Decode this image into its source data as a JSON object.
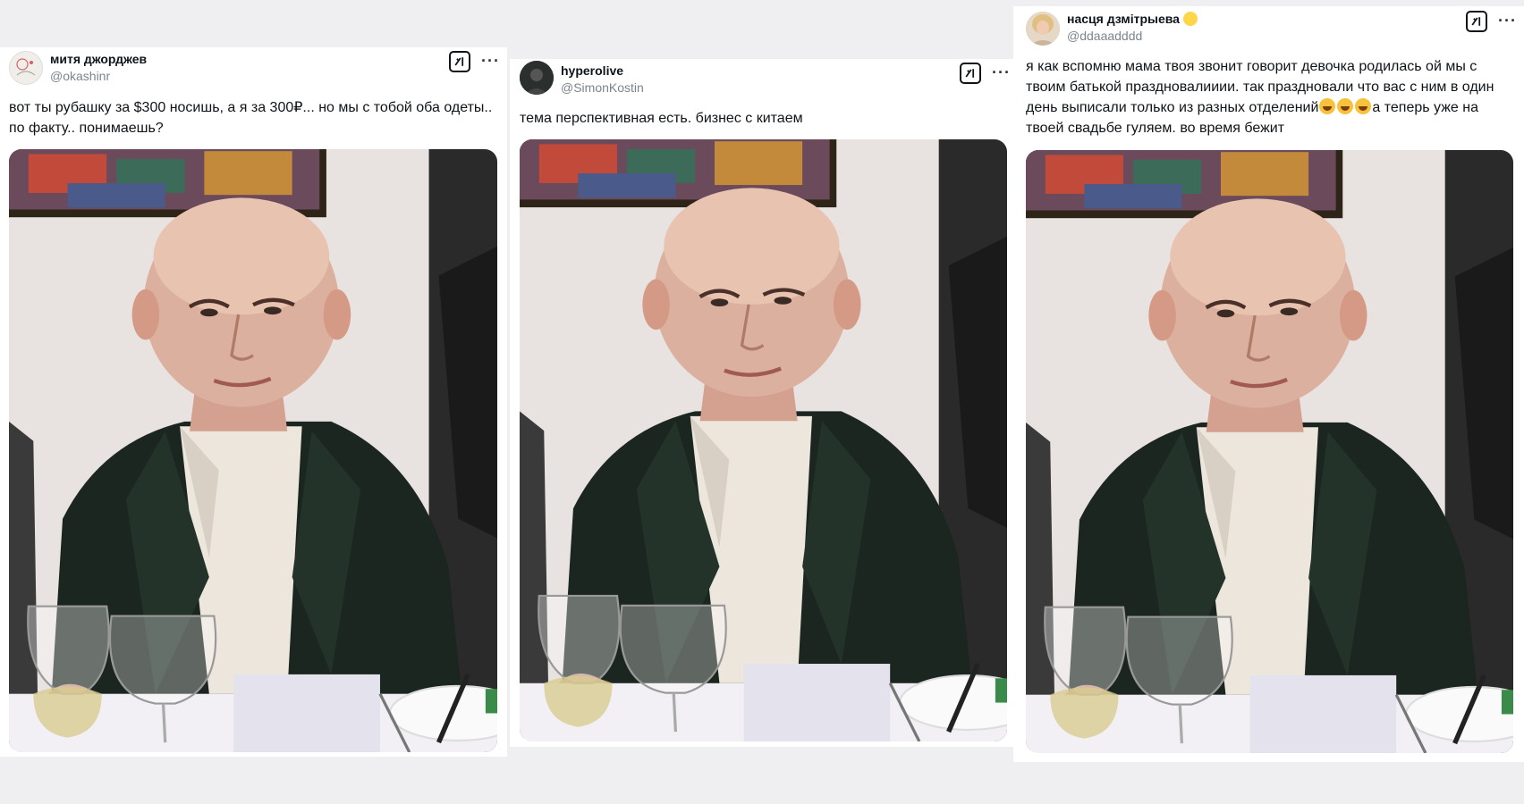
{
  "tweets": [
    {
      "name": "митя джорджев",
      "handle": "@okashinr",
      "text": "вот ты рубашку за $300 носишь, а я за 300₽... но мы с тобой оба одеты.. по факту.. понимаешь?",
      "avatar_icon": "avatar-sketch-icon"
    },
    {
      "name": "hyperolive",
      "handle": "@SimonKostin",
      "text": "тема перспективная есть. бизнес с китаем",
      "avatar_icon": "avatar-dark-icon"
    },
    {
      "name": "насця дзмітрыева",
      "handle": "@ddaaadddd",
      "text_part1": "я как вспомню мама твоя звонит говорит девочка родилась ой мы с твоим батькой праздновалииии. так праздновали что вас с ним в один день выписали только из разных отделений",
      "text_part2": "а теперь уже на твоей свадьбе гуляем. во время бежит",
      "avatar_icon": "avatar-blonde-icon",
      "name_emoji": "chick-emoji-icon"
    }
  ],
  "icons": {
    "grok": "grok-icon",
    "more": "more-options-icon",
    "laugh": "grinning-emoji-icon"
  },
  "colors": {
    "handle_gray": "#7a8590",
    "jacket": "#1c2620",
    "wall": "#e9e4e2"
  }
}
